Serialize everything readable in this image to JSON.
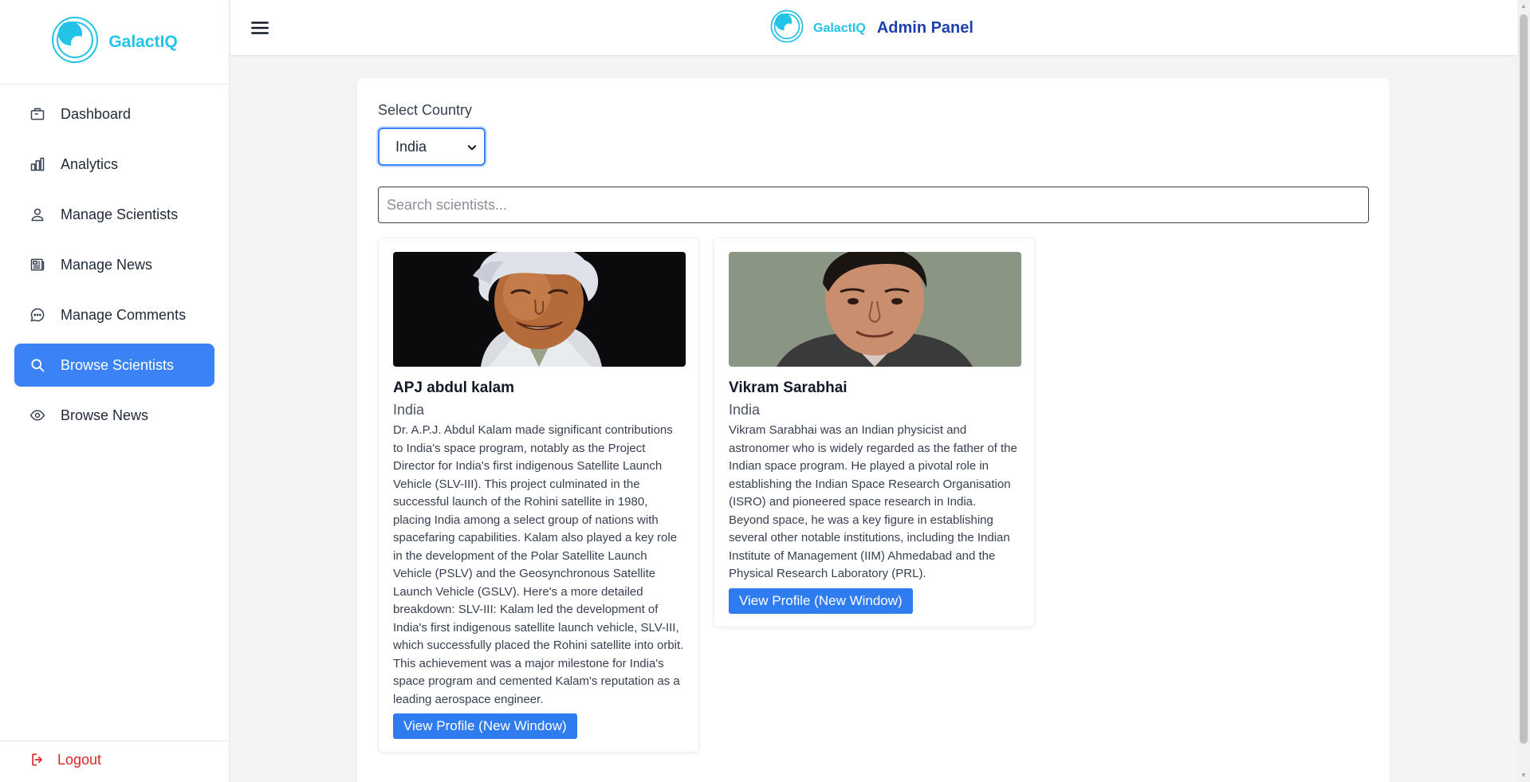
{
  "app": {
    "brand": "GalactIQ",
    "admin_title": "Admin Panel"
  },
  "sidebar": {
    "items": [
      {
        "label": "Dashboard",
        "icon": "dashboard-icon"
      },
      {
        "label": "Analytics",
        "icon": "bar-chart-icon"
      },
      {
        "label": "Manage Scientists",
        "icon": "user-icon"
      },
      {
        "label": "Manage News",
        "icon": "newspaper-icon"
      },
      {
        "label": "Manage Comments",
        "icon": "comment-icon"
      },
      {
        "label": "Browse Scientists",
        "icon": "search-icon",
        "active": true
      },
      {
        "label": "Browse News",
        "icon": "eye-icon"
      }
    ],
    "logout": "Logout"
  },
  "filter": {
    "label": "Select Country",
    "selected": "India"
  },
  "search": {
    "placeholder": "Search scientists..."
  },
  "scientists": [
    {
      "name": "APJ abdul kalam",
      "country": "India",
      "bio": "Dr. A.P.J. Abdul Kalam made significant contributions to India's space program, notably as the Project Director for India's first indigenous Satellite Launch Vehicle (SLV-III). This project culminated in the successful launch of the Rohini satellite in 1980, placing India among a select group of nations with spacefaring capabilities. Kalam also played a key role in the development of the Polar Satellite Launch Vehicle (PSLV) and the Geosynchronous Satellite Launch Vehicle (GSLV). Here's a more detailed breakdown: SLV-III: Kalam led the development of India's first indigenous satellite launch vehicle, SLV-III, which successfully placed the Rohini satellite into orbit. This achievement was a major milestone for India's space program and cemented Kalam's reputation as a leading aerospace engineer.",
      "button": "View Profile (New Window)"
    },
    {
      "name": "Vikram Sarabhai",
      "country": "India",
      "bio": "Vikram Sarabhai was an Indian physicist and astronomer who is widely regarded as the father of the Indian space program. He played a pivotal role in establishing the Indian Space Research Organisation (ISRO) and pioneered space research in India. Beyond space, he was a key figure in establishing several other notable institutions, including the Indian Institute of Management (IIM) Ahmedabad and the Physical Research Laboratory (PRL).",
      "button": "View Profile (New Window)"
    }
  ],
  "colors": {
    "accent": "#3b82f6",
    "brand": "#22c3e6",
    "title": "#1e40af",
    "danger": "#dc2626"
  }
}
